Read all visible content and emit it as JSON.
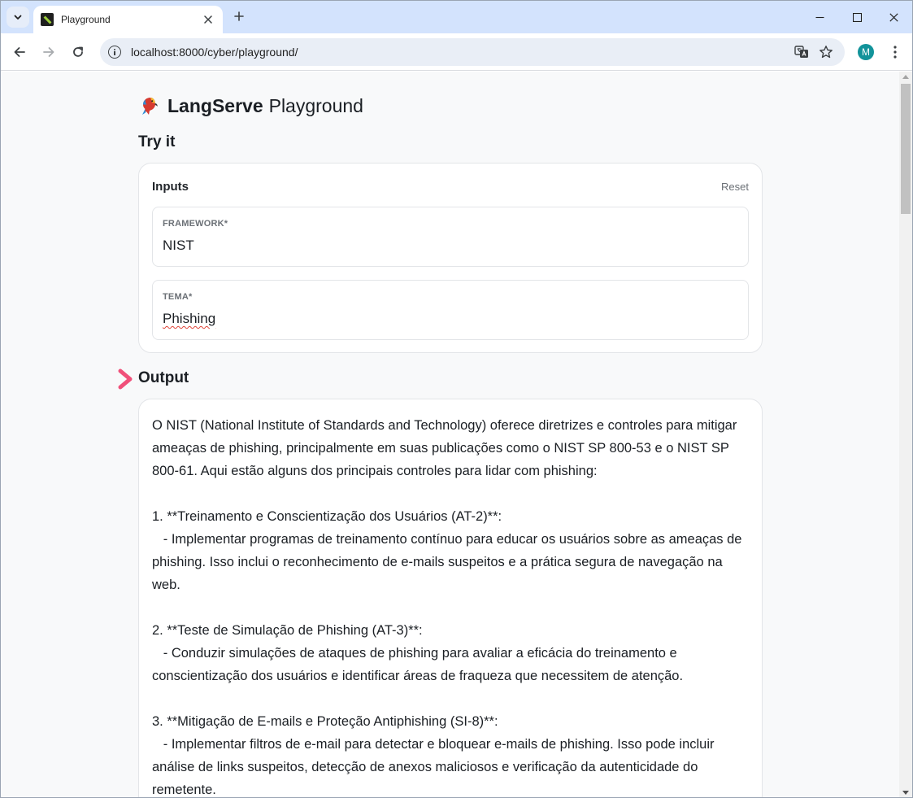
{
  "browser": {
    "tab_title": "Playground",
    "url": "localhost:8000/cyber/playground/",
    "profile_initial": "M",
    "accent_color": "#d3e3fd"
  },
  "page": {
    "brand": "LangServe",
    "brand_suffix": "Playground",
    "try_it_heading": "Try it",
    "inputs": {
      "label": "Inputs",
      "reset_label": "Reset",
      "fields": [
        {
          "label": "FRAMEWORK*",
          "value": "NIST"
        },
        {
          "label": "TEMA*",
          "value": "Phishing"
        }
      ]
    },
    "output_heading": "Output",
    "output_text": "O NIST (National Institute of Standards and Technology) oferece diretrizes e controles para mitigar ameaças de phishing, principalmente em suas publicações como o NIST SP 800-53 e o NIST SP 800-61. Aqui estão alguns dos principais controles para lidar com phishing:\n\n1. **Treinamento e Conscientização dos Usuários (AT-2)**:\n   - Implementar programas de treinamento contínuo para educar os usuários sobre as ameaças de phishing. Isso inclui o reconhecimento de e-mails suspeitos e a prática segura de navegação na web.\n\n2. **Teste de Simulação de Phishing (AT-3)**:\n   - Conduzir simulações de ataques de phishing para avaliar a eficácia do treinamento e conscientização dos usuários e identificar áreas de fraqueza que necessitem de atenção.\n\n3. **Mitigação de E-mails e Proteção Antiphishing (SI-8)**:\n   - Implementar filtros de e-mail para detectar e bloquear e-mails de phishing. Isso pode incluir análise de links suspeitos, detecção de anexos maliciosos e verificação da autenticidade do remetente.",
    "arrow_color": "#f0507a"
  }
}
